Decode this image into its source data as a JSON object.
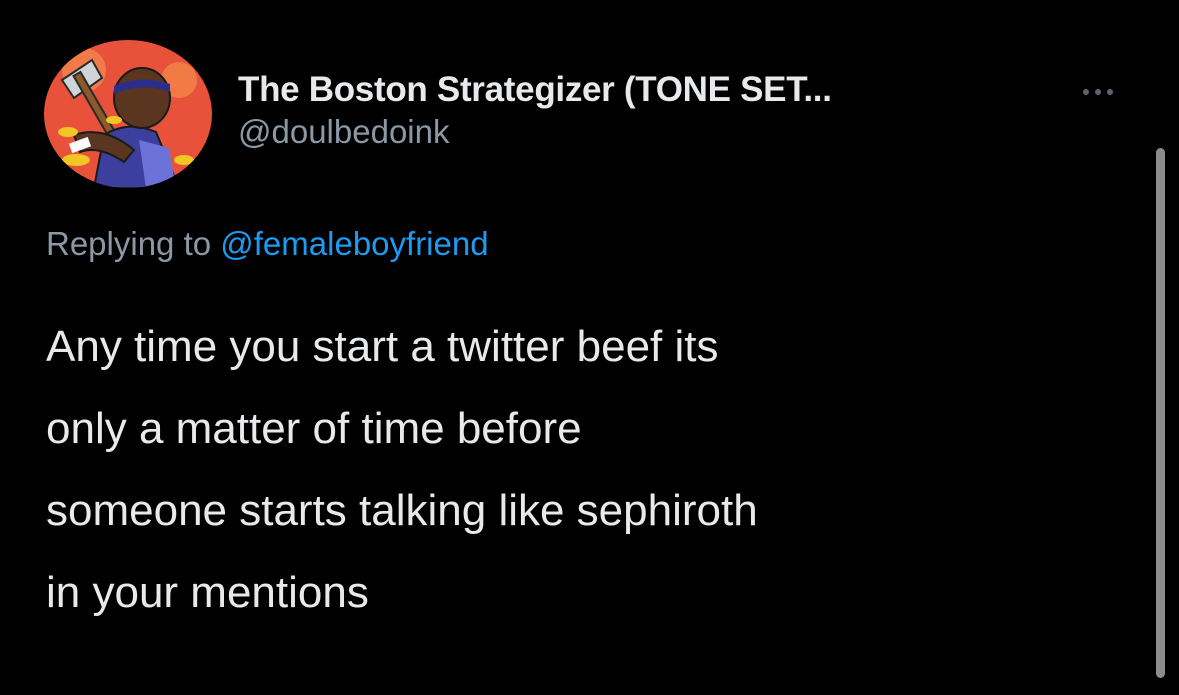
{
  "author": {
    "display_name": "The Boston Strategizer (TONE SET...",
    "handle": "@doulbedoink",
    "avatar_icon": "profile-avatar-illustration"
  },
  "more_icon": "ellipsis-icon",
  "reply": {
    "prefix": "Replying to ",
    "mention": "@femaleboyfriend"
  },
  "tweet": {
    "text": "Any time you start a twitter beef its\nonly a matter of time before\nsomeone starts talking like sephiroth\nin your mentions"
  },
  "colors": {
    "background": "#000000",
    "text": "#e7e9ea",
    "secondary": "#8b98a5",
    "link": "#1d9bf0"
  }
}
